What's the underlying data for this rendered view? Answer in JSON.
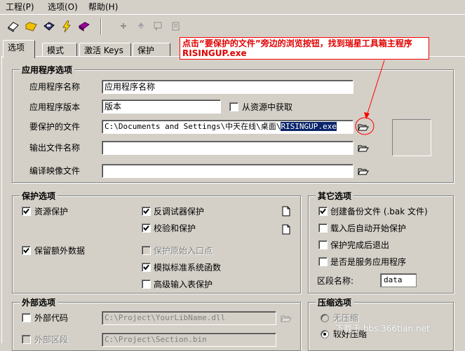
{
  "menu": {
    "project": "工程(P)",
    "options": "选项(O)",
    "help": "帮助(H)"
  },
  "toolbar": {
    "icons": [
      "new-project-icon",
      "open-folder-icon",
      "save-disk-icon",
      "build-lightning-icon",
      "book-icon",
      "pin-icon",
      "up-icon",
      "comment-icon",
      "report-icon"
    ]
  },
  "tabs": [
    {
      "label": "选项"
    },
    {
      "label": "模式"
    },
    {
      "label": "激活 Keys"
    },
    {
      "label": "保护"
    }
  ],
  "annotation": {
    "line1": "点击“要保护的文件”旁边的浏览按钮，找到瑞星工具箱主程序",
    "line2": "RISINGUP.exe",
    "color": "#ff0000"
  },
  "app_options": {
    "title": "应用程序选项",
    "app_name_label": "应用程序名称",
    "app_name_value": "应用程序名称",
    "app_version_label": "应用程序版本",
    "app_version_value": "版本",
    "from_resource_label": "从资源中获取",
    "protected_file_label": "要保护的文件",
    "protected_file_prefix": "C:\\Documents and Settings\\中天在线\\桌面\\",
    "protected_file_selected": "RISINGUP.exe",
    "output_name_label": "输出文件名称",
    "output_name_value": "",
    "compiled_image_label": "编译映像文件",
    "compiled_image_value": ""
  },
  "protect_options": {
    "title": "保护选项",
    "resource_protect": "资源保护",
    "preserve_extra": "保留额外数据",
    "anti_debugger": "反调试器保护",
    "checksum_protect": "校验和保护",
    "protect_entry": "保护原始入口点",
    "emulate_std_funcs": "模拟标准系统函数",
    "advanced_import": "高级输入表保护"
  },
  "other_options": {
    "title": "其它选项",
    "create_backup": "创建备份文件 (.bak 文件)",
    "auto_protect": "载入后自动开始保护",
    "exit_after": "保护完成后退出",
    "is_service": "是否是服务应用程序",
    "section_name_label": "区段名称:",
    "section_name_value": "data"
  },
  "external_options": {
    "title": "外部选项",
    "external_code": "外部代码",
    "external_code_path": "C:\\Project\\YourLibName.dll",
    "external_section": "外部区段",
    "external_section_path": "C:\\Project\\Section.bin"
  },
  "compress": {
    "title": "压缩选项",
    "none": "无压缩",
    "better": "较好压缩"
  },
  "watermark": "下载于 bbs.366tian.net"
}
